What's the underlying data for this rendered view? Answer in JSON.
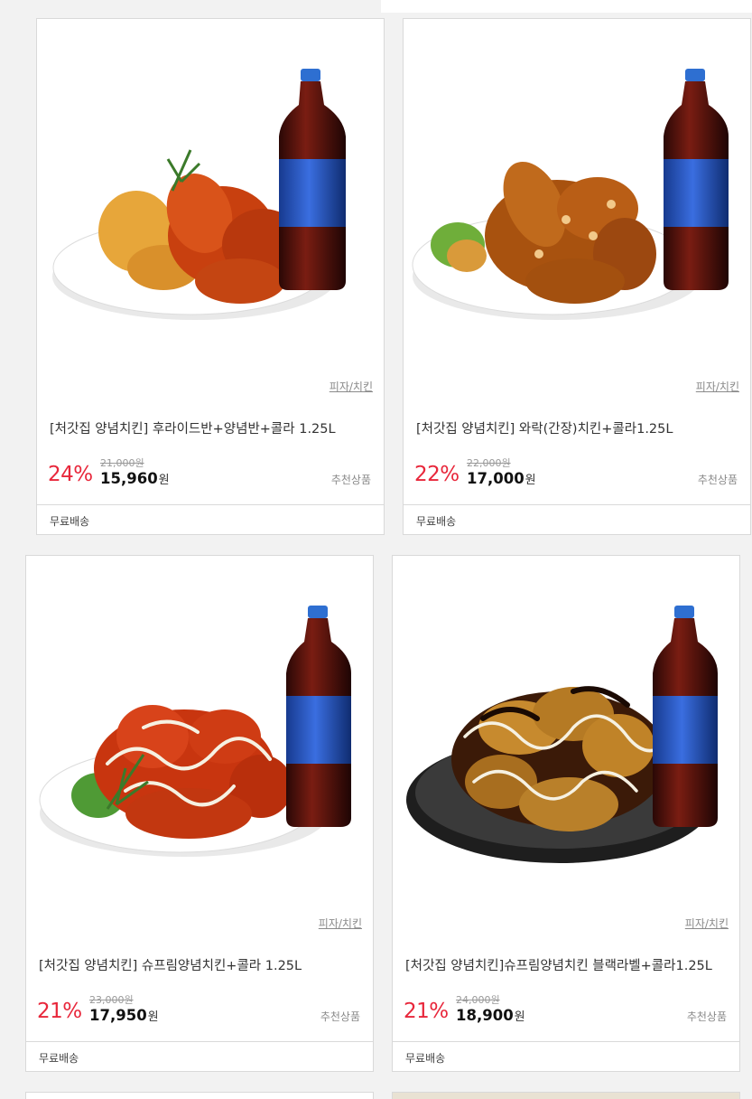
{
  "products": [
    {
      "category": "피자/치킨",
      "name": "[처갓집 양념치킨] 후라이드반+양념반+콜라 1.25L",
      "original_price": "21,000원",
      "discount_rate": "24%",
      "sale_price": "15,960",
      "currency": "원",
      "badge": "추천상품",
      "shipping": "무료배송",
      "image": "fried-half-seasoned-half-chicken-with-cola"
    },
    {
      "category": "피자/치킨",
      "name": "[처갓집 양념치킨] 와락(간장)치킨+콜라1.25L",
      "original_price": "22,000원",
      "discount_rate": "22%",
      "sale_price": "17,000",
      "currency": "원",
      "badge": "추천상품",
      "shipping": "무료배송",
      "image": "soy-garlic-chicken-with-cola"
    },
    {
      "category": "피자/치킨",
      "name": "[처갓집 양념치킨] 슈프림양념치킨+콜라 1.25L",
      "original_price": "23,000원",
      "discount_rate": "21%",
      "sale_price": "17,950",
      "currency": "원",
      "badge": "추천상품",
      "shipping": "무료배송",
      "image": "supreme-seasoned-chicken-with-cola"
    },
    {
      "category": "피자/치킨",
      "name": "[처갓집 양념치킨]슈프림양념치킨 블랙라벨+콜라1.25L",
      "original_price": "24,000원",
      "discount_rate": "21%",
      "sale_price": "18,900",
      "currency": "원",
      "badge": "추천상품",
      "shipping": "무료배송",
      "image": "supreme-black-label-chicken-with-cola"
    }
  ],
  "colors": {
    "discount": "#e8273b",
    "background": "#f2f2f2",
    "card_border": "#d9d9d9"
  }
}
